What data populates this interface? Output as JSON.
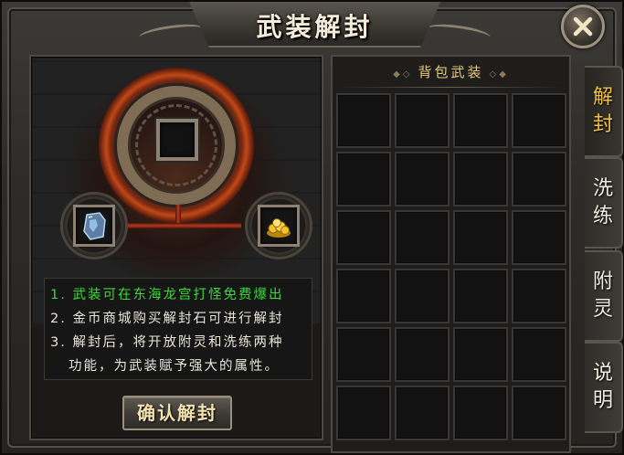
{
  "window": {
    "title": "武装解封"
  },
  "tabs": [
    {
      "line1": "解",
      "line2": "封",
      "active": true
    },
    {
      "line1": "洗",
      "line2": "练",
      "active": false
    },
    {
      "line1": "附",
      "line2": "灵",
      "active": false
    },
    {
      "line1": "说",
      "line2": "明",
      "active": false
    }
  ],
  "unseal": {
    "info_lines": [
      "1. 武装可在东海龙宫打怪免费爆出",
      "2. 金币商城购买解封石可进行解封",
      "3. 解封后，将开放附灵和洗练两种",
      "功能，为武装赋予强大的属性。"
    ],
    "confirm_label": "确认解封",
    "highlight_color": "#3ed63a"
  },
  "bag": {
    "header": "背包武装",
    "columns": 4,
    "rows": 6
  },
  "icons": {
    "close": "close-x-icon",
    "unseal_stone": "unseal-stone-icon",
    "gold": "gold-coins-icon"
  }
}
